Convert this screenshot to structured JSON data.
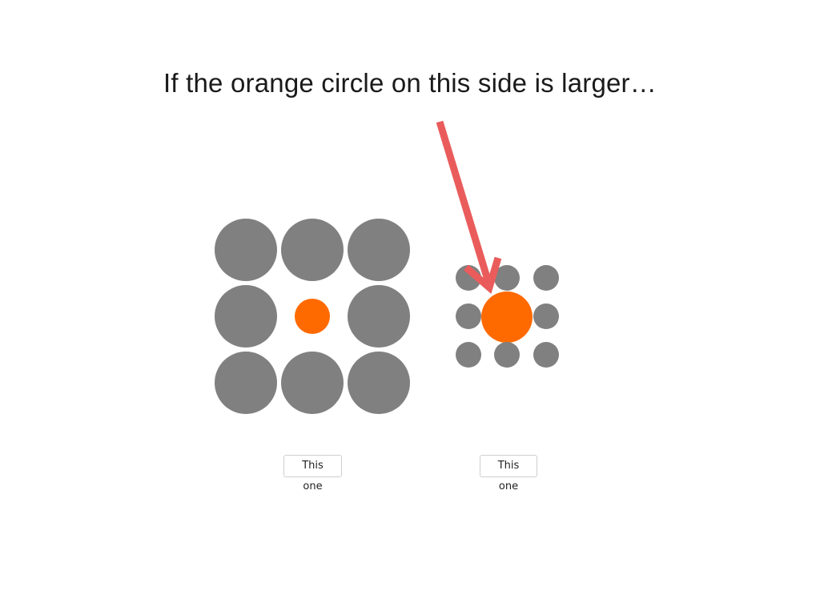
{
  "prompt": {
    "text": "If the orange circle on this side is larger…"
  },
  "colors": {
    "gray_circle": "#808080",
    "orange_circle": "#ff6a00",
    "arrow": "#ea5c5c",
    "background": "#ffffff"
  },
  "choices": {
    "left_label": "This one",
    "right_label": "This one"
  }
}
